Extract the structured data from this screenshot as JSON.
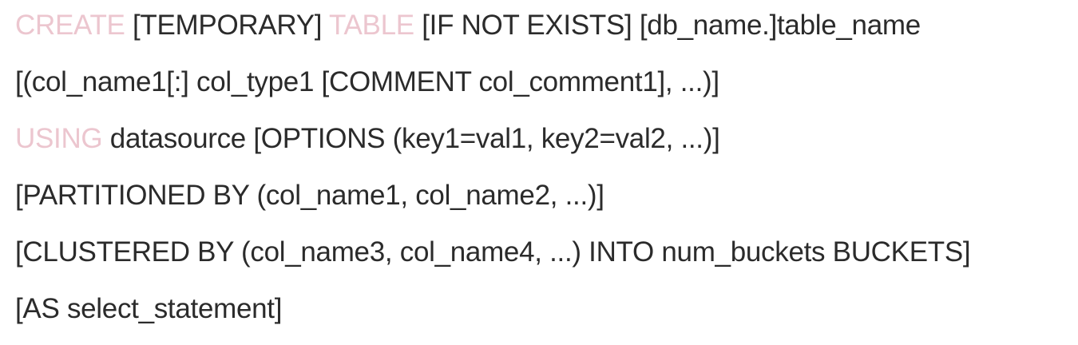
{
  "syntax": {
    "line1": {
      "kw_create": "CREATE",
      "seg1": " [TEMPORARY] ",
      "kw_table": "TABLE",
      "seg2": " [IF NOT EXISTS] [db_name.]table_name"
    },
    "line2": {
      "text": "[(col_name1[:] col_type1 [COMMENT col_comment1], ...)]"
    },
    "line3": {
      "kw_using": "USING",
      "seg1": " datasource [OPTIONS (key1=val1, key2=val2, ...)]"
    },
    "line4": {
      "text": "[PARTITIONED BY (col_name1, col_name2, ...)]"
    },
    "line5": {
      "text": "[CLUSTERED BY (col_name3, col_name4, ...) INTO num_buckets BUCKETS]"
    },
    "line6": {
      "text": "[AS select_statement]"
    }
  },
  "colors": {
    "keyword": "#ecc6cf",
    "text": "#2b2b2b",
    "background": "#ffffff"
  }
}
